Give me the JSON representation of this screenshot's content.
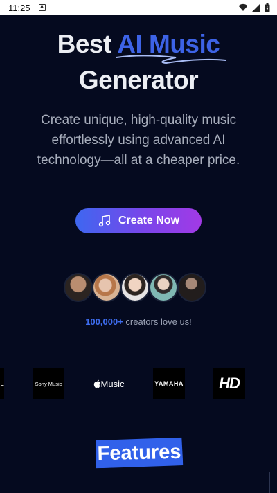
{
  "status_bar": {
    "time": "11:25",
    "app_icon_letter": "A",
    "icons": [
      "wifi-icon",
      "signal-icon",
      "battery-icon"
    ]
  },
  "hero": {
    "title_word1": "Best",
    "title_accent": "AI Music",
    "title_line2": "Generator",
    "subtitle": "Create unique, high-quality music effortlessly using advanced AI technology—all at a cheaper price."
  },
  "cta": {
    "label": "Create Now",
    "icon": "music-note-icon"
  },
  "social_proof": {
    "count": "100,000+",
    "text": " creators love us!"
  },
  "brands": {
    "partial": "L",
    "sony": "Sony Music",
    "apple": "Music",
    "yamaha": "YAMAHA",
    "hd": "HD"
  },
  "features": {
    "label": "Features"
  },
  "colors": {
    "background": "#050a1f",
    "accent_blue": "#3d63e6",
    "gradient_end": "#a23ae6",
    "features_bg": "#3161ea"
  }
}
